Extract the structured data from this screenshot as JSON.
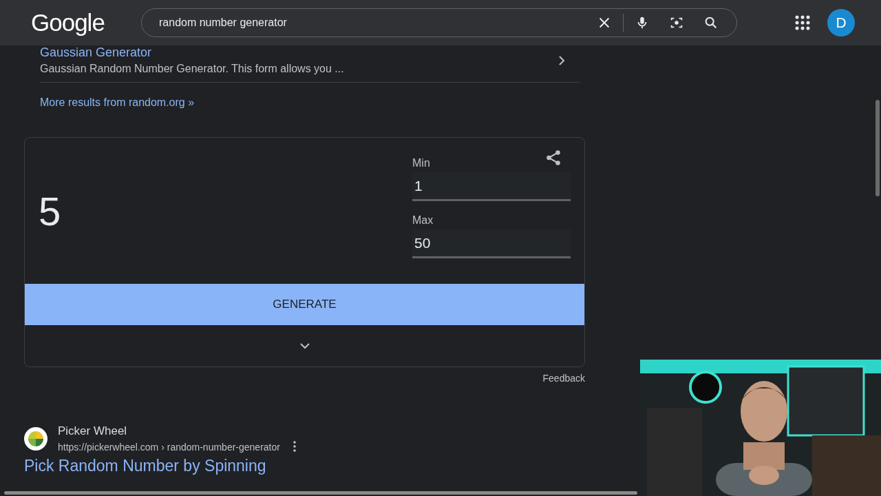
{
  "header": {
    "logo": "Google",
    "search": {
      "value": "random number generator"
    },
    "avatar": "D"
  },
  "site_links": [
    {
      "title": "Gaussian Generator",
      "snippet": "Gaussian Random Number Generator. This form allows you ..."
    }
  ],
  "more_results": "More results from random.org »",
  "rng": {
    "result": "5",
    "fields": [
      {
        "label": "Min",
        "value": "1"
      },
      {
        "label": "Max",
        "value": "50"
      }
    ],
    "button": "GENERATE"
  },
  "feedback": "Feedback",
  "result": {
    "site": "Picker Wheel",
    "url": "https://pickerwheel.com › random-number-generator",
    "title": "Pick Random Number by Spinning"
  }
}
